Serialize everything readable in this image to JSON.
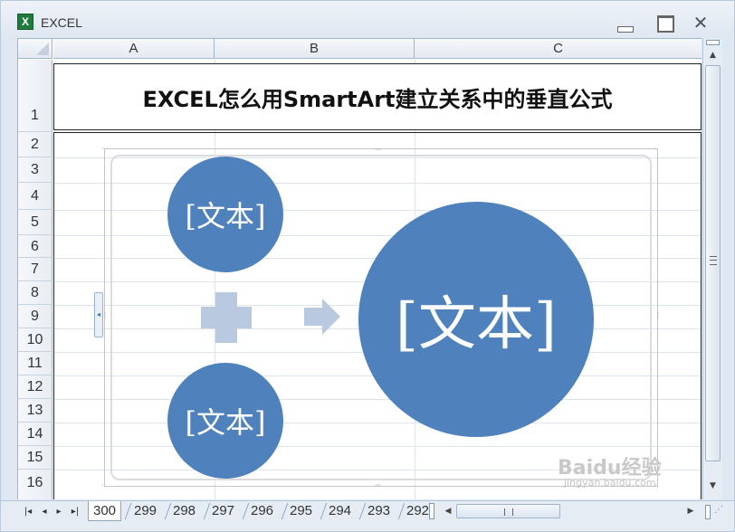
{
  "window": {
    "title": "EXCEL",
    "app_icon": "excel-icon",
    "close_glyph": "✕"
  },
  "columns": [
    {
      "label": "A"
    },
    {
      "label": "B"
    },
    {
      "label": "C"
    }
  ],
  "rows": [
    "1",
    "2",
    "3",
    "4",
    "5",
    "6",
    "7",
    "8",
    "9",
    "10",
    "11",
    "12",
    "13",
    "14",
    "15",
    "16"
  ],
  "merged_title": "EXCEL怎么用SmartArt建立关系中的垂直公式",
  "smartart": {
    "input_top": "[文本]",
    "input_bottom": "[文本]",
    "result": "[文本]",
    "colors": {
      "circle": "#4f81bd",
      "operator": "#b9c9df"
    }
  },
  "sheet_tabs": [
    "300",
    "299",
    "298",
    "297",
    "296",
    "295",
    "294",
    "293",
    "292"
  ],
  "active_sheet": "300",
  "watermark": {
    "main": "Baidu经验",
    "sub": "jingyan.baidu.com"
  }
}
